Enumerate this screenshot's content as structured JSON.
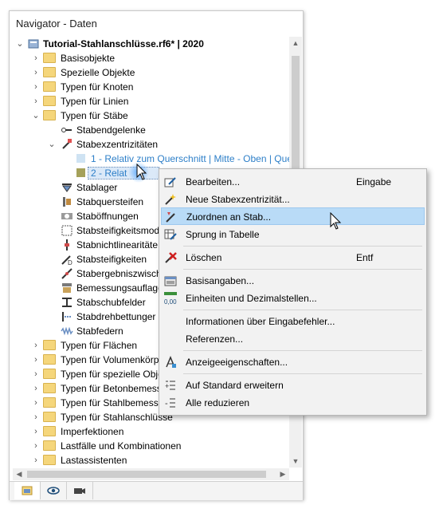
{
  "panel": {
    "title": "Navigator - Daten"
  },
  "tree": {
    "root": "Tutorial-Stahlanschlüsse.rf6* | 2020",
    "items": [
      {
        "label": "Basisobjekte"
      },
      {
        "label": "Spezielle Objekte"
      },
      {
        "label": "Typen für Knoten"
      },
      {
        "label": "Typen für Linien"
      },
      {
        "label": "Typen für Stäbe"
      },
      {
        "label": "Stabendgelenke"
      },
      {
        "label": "Stabexzentrizitäten"
      },
      {
        "label": "1 - Relativ zum Querschnitt | Mitte - Oben | Quer"
      },
      {
        "label": "2 - Relat"
      },
      {
        "label": "Stablager"
      },
      {
        "label": "Stabquersteifen"
      },
      {
        "label": "Staböffnungen"
      },
      {
        "label": "Stabsteifigkeitsmod"
      },
      {
        "label": "Stabnichtlinearitäte"
      },
      {
        "label": "Stabsteifigkeiten"
      },
      {
        "label": "Stabergebniszwisch"
      },
      {
        "label": "Bemessungsauflage"
      },
      {
        "label": "Stabschubfelder"
      },
      {
        "label": "Stabdrehbettunger"
      },
      {
        "label": "Stabfedern"
      },
      {
        "label": "Typen für Flächen"
      },
      {
        "label": "Typen für Volumenkörp"
      },
      {
        "label": "Typen für spezielle Obje"
      },
      {
        "label": "Typen für Betonbemess"
      },
      {
        "label": "Typen für Stahlbemessu"
      },
      {
        "label": "Typen für Stahlanschlüsse"
      },
      {
        "label": "Imperfektionen"
      },
      {
        "label": "Lastfälle und Kombinationen"
      },
      {
        "label": "Lastassistenten"
      }
    ]
  },
  "context_menu": {
    "items": [
      {
        "label": "Bearbeiten...",
        "shortcut": "Eingabe",
        "icon": "edit-icon"
      },
      {
        "label": "Neue Stabexzentrizität...",
        "shortcut": "",
        "icon": "new-item-icon"
      },
      {
        "label": "Zuordnen an Stab...",
        "shortcut": "",
        "icon": "assign-icon"
      },
      {
        "label": "Sprung in Tabelle",
        "shortcut": "",
        "icon": "table-jump-icon"
      },
      {
        "label": "Löschen",
        "shortcut": "Entf",
        "icon": "delete-icon"
      },
      {
        "label": "Basisangaben...",
        "shortcut": "",
        "icon": "base-data-icon"
      },
      {
        "label": "Einheiten und Dezimalstellen...",
        "shortcut": "",
        "icon": "units-icon"
      },
      {
        "label": "Informationen über Eingabefehler...",
        "shortcut": "",
        "icon": ""
      },
      {
        "label": "Referenzen...",
        "shortcut": "",
        "icon": ""
      },
      {
        "label": "Anzeigeeigenschaften...",
        "shortcut": "",
        "icon": "display-props-icon"
      },
      {
        "label": "Auf Standard erweitern",
        "shortcut": "",
        "icon": "expand-icon"
      },
      {
        "label": "Alle reduzieren",
        "shortcut": "",
        "icon": "collapse-icon"
      }
    ],
    "units_icon_text": "0,00"
  },
  "colors": {
    "hover": "#b9dbf7",
    "link": "#2d7fc8",
    "folder": "#f5d67b"
  }
}
